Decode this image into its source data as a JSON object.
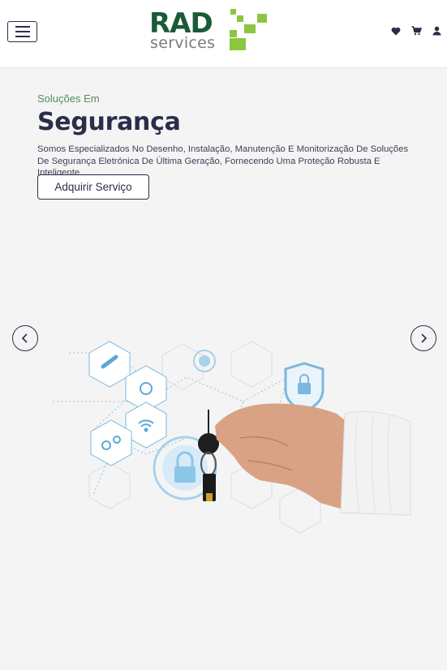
{
  "header": {
    "logo": {
      "word_top": "RAD",
      "word_bottom": "services"
    },
    "icons": [
      "heart-icon",
      "cart-icon",
      "user-icon"
    ]
  },
  "hero": {
    "subtitle": "Soluções Em",
    "title": "Segurança",
    "description": "Somos Especializados No Desenho, Instalação, Manutenção E Monitorização De Soluções De Segurança Eletrónica De Última Geração, Fornecendo Uma Proteção Robusta E Inteligente.",
    "cta_label": "Adquirir Serviço"
  },
  "carousel": {
    "prev_icon": "chevron-left-icon",
    "next_icon": "chevron-right-icon"
  },
  "colors": {
    "brand_dark": "#2b2d4a",
    "brand_green": "#1b5a36",
    "accent_green": "#8cc63f",
    "subtitle_green": "#4f8f5f",
    "icon_blue": "#5aa9d6"
  }
}
